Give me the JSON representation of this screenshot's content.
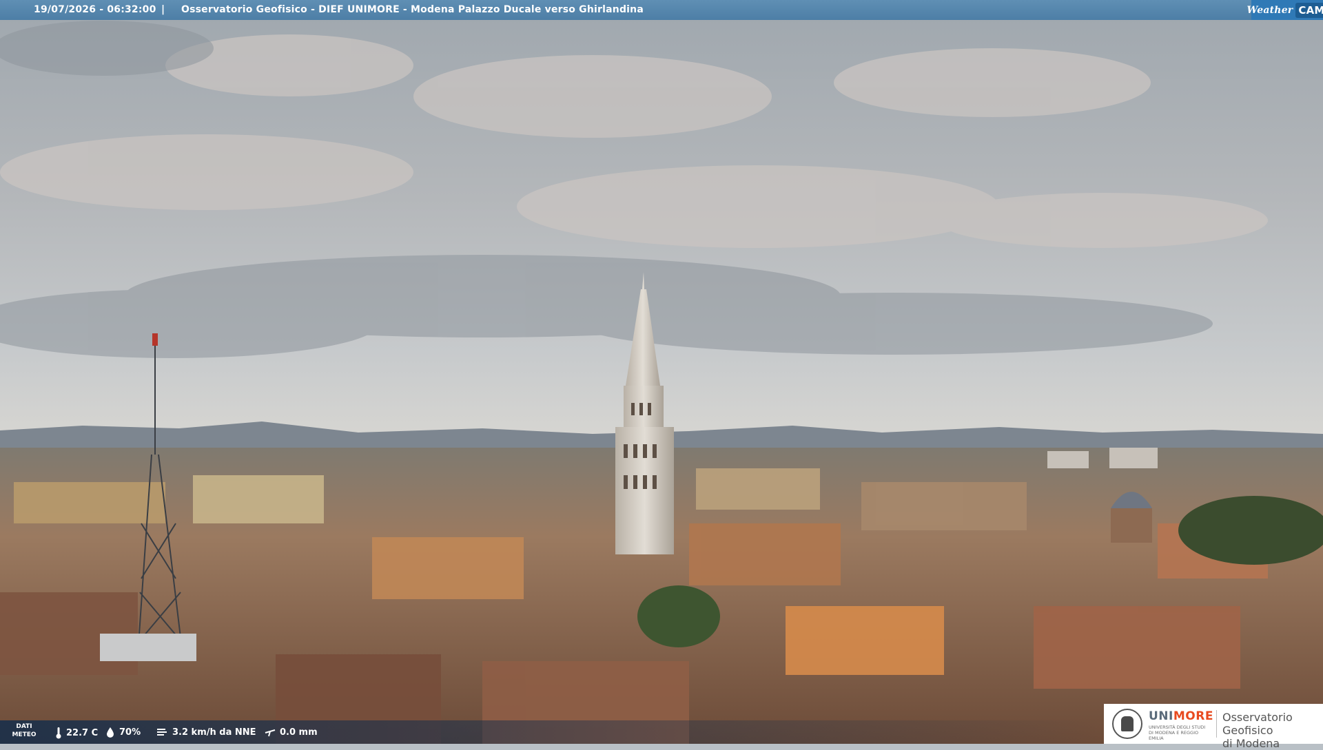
{
  "header": {
    "datetime": "19/07/2026 - 06:32:00",
    "separator": "|",
    "title": "Osservatorio Geofisico - DIEF UNIMORE - Modena Palazzo Ducale verso Ghirlandina",
    "brand_weather": "Weather",
    "brand_cam": "CAM"
  },
  "meteo": {
    "label_line1": "DATI",
    "label_line2": "METEO",
    "temperature": "22.7 C",
    "humidity": "70%",
    "wind": "3.2 km/h da NNE",
    "rain": "0.0 mm"
  },
  "logo": {
    "uni": "UNI",
    "more": "MORE",
    "uni_sub": "UNIVERSITÀ DEGLI STUDI DI MODENA E REGGIO EMILIA",
    "obs_line1": "Osservatorio Geofisico",
    "obs_line2": "di Modena"
  },
  "colors": {
    "topbar": "#4d7ea6",
    "brand_orange": "#e84a1f"
  },
  "icons": [
    "thermometer-icon",
    "humidity-drop-icon",
    "wind-icon",
    "rain-gauge-icon",
    "camera-brand-icon"
  ]
}
